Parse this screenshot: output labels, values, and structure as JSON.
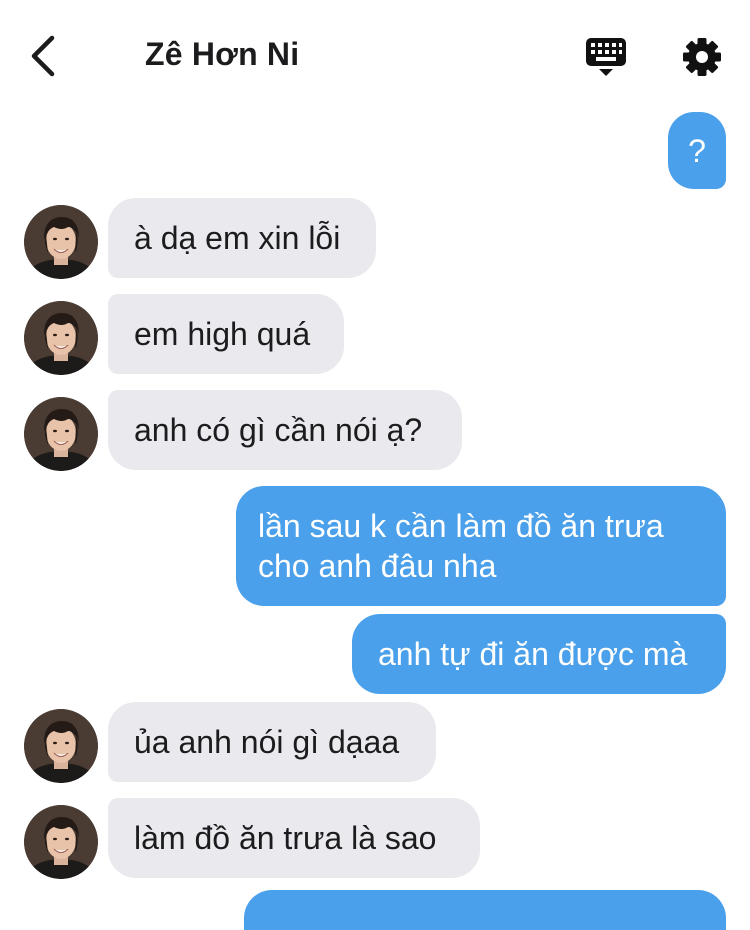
{
  "header": {
    "back_icon": "chevron-left-icon",
    "title": "Zê Hơn Ni",
    "keyboard_icon": "keyboard-icon",
    "settings_icon": "gear-icon"
  },
  "messages": [
    {
      "direction": "outgoing",
      "text": "?"
    },
    {
      "direction": "incoming",
      "text": "à dạ em xin lỗi"
    },
    {
      "direction": "incoming",
      "text": "em high quá"
    },
    {
      "direction": "incoming",
      "text": "anh có gì cần nói ạ?"
    },
    {
      "direction": "outgoing",
      "text": "lần sau k cần làm đồ ăn trưa cho anh đâu nha"
    },
    {
      "direction": "outgoing",
      "text": "anh tự đi ăn được mà"
    },
    {
      "direction": "incoming",
      "text": "ủa anh nói gì dạaa"
    },
    {
      "direction": "incoming",
      "text": "làm đồ ăn trưa là sao"
    }
  ],
  "colors": {
    "outgoing_bubble": "#4aa0ea",
    "incoming_bubble": "#e9e9ee",
    "text_dark": "#1c1c1e"
  }
}
